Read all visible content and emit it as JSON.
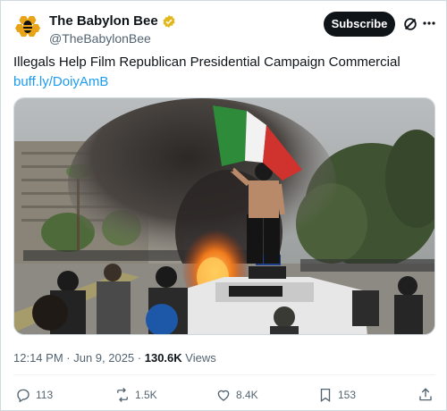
{
  "account": {
    "display_name": "The Babylon Bee",
    "handle": "@TheBabylonBee",
    "verified": true,
    "avatar_icon": "bee-logo-icon"
  },
  "header": {
    "subscribe_label": "Subscribe",
    "grok_icon": "grok-icon",
    "more_icon": "more-icon"
  },
  "tweet": {
    "text": "Illegals Help Film Republican Presidential Campaign Commercial ",
    "link_text": "buff.ly/DoiyAmB"
  },
  "media": {
    "type": "photo",
    "alt": ""
  },
  "meta": {
    "time": "12:14 PM",
    "separator": " · ",
    "date": "Jun 9, 2025",
    "separator2": " · ",
    "views_count": "130.6K",
    "views_label": " Views"
  },
  "actions": {
    "replies": "113",
    "reposts": "1.5K",
    "likes": "8.4K",
    "bookmarks": "153"
  },
  "colors": {
    "accent_link": "#1d9bf0",
    "verified_badge": "#e2b719",
    "text_primary": "#0f1419",
    "text_secondary": "#536471"
  }
}
